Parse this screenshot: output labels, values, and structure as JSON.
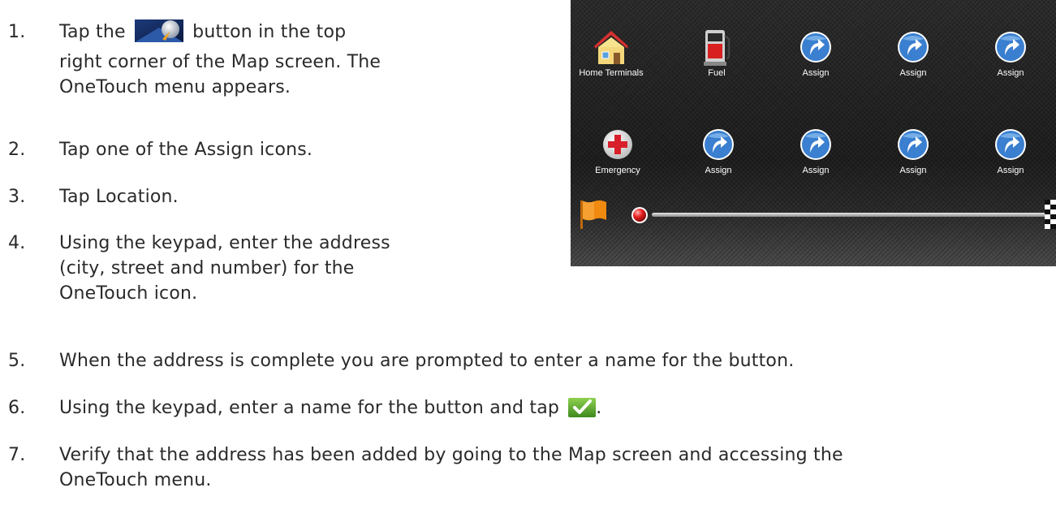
{
  "steps": [
    {
      "num": "1.",
      "text_before": "Tap the",
      "text_after": "button in the top",
      "line2": "right corner of the Map screen. The",
      "line3": "OneTouch menu appears.",
      "icon": "onetouch-menu-icon"
    },
    {
      "num": "2.",
      "text": "Tap one of the Assign icons."
    },
    {
      "num": "3.",
      "text": "Tap Location."
    },
    {
      "num": "4.",
      "line1": "Using the keypad, enter the address",
      "line2": "(city, street and number) for the",
      "line3": "OneTouch icon."
    },
    {
      "num": "5.",
      "text": "When the address is complete you are prompted to enter a name for the button."
    },
    {
      "num": "6.",
      "text_before": "Using the keypad, enter a name for the button and tap",
      "text_after": ".",
      "icon": "checkmark-icon"
    },
    {
      "num": "7.",
      "line1": "Verify that the address has been added by going to the Map screen and accessing the",
      "line2": "OneTouch menu."
    }
  ],
  "onetouch_menu": {
    "row1": [
      {
        "label": "Home Terminals",
        "icon": "house-icon"
      },
      {
        "label": "Fuel",
        "icon": "fuel-pump-icon"
      },
      {
        "label": "Assign",
        "icon": "assign-arrow-icon"
      },
      {
        "label": "Assign",
        "icon": "assign-arrow-icon"
      },
      {
        "label": "Assign",
        "icon": "assign-arrow-icon"
      }
    ],
    "row2": [
      {
        "label": "Emergency",
        "icon": "emergency-cross-icon"
      },
      {
        "label": "Assign",
        "icon": "assign-arrow-icon"
      },
      {
        "label": "Assign",
        "icon": "assign-arrow-icon"
      },
      {
        "label": "Assign",
        "icon": "assign-arrow-icon"
      },
      {
        "label": "Assign",
        "icon": "assign-arrow-icon"
      }
    ],
    "colors": {
      "assign_blue": "#3a7fd0",
      "emergency_red": "#d8202a",
      "start_flag": "#f08a10"
    }
  }
}
